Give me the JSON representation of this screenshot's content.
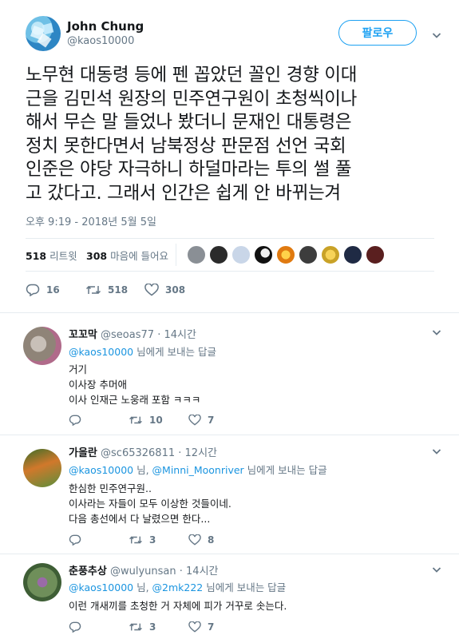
{
  "main_tweet": {
    "author_name": "John Chung",
    "author_handle": "@kaos10000",
    "follow_label": "팔로우",
    "text_lines": [
      "노무현 대동령 등에 펜 꼽았던 꼴인 경향 이대",
      "근을 김민석 원장의 민주연구원이 초청씩이나",
      "해서 무슨 말 들었나 봤더니 문재인 대통령은",
      "정치 못한다면서 남북정상 판문점 선언 국회",
      "인준은 야당 자극하니 하덜마라는 투의 썰 풀",
      "고 갔다고. 그래서 인간은 쉽게 안 바뀌는겨"
    ],
    "timestamp": "오후 9:19 - 2018년 5월 5일",
    "retweets_count": "518",
    "retweets_label": "리트윗",
    "likes_count": "308",
    "likes_label": "마음에 들어요",
    "actions": {
      "replies": "16",
      "retweets": "518",
      "likes": "308"
    }
  },
  "replies": [
    {
      "name": "꼬꼬막",
      "handle": "@seoas77",
      "time": "· 14시간",
      "to_prefix": "",
      "to_mentions": [
        "@kaos10000"
      ],
      "to_suffix": " 님에게 보내는 답글",
      "lines": [
        "거기",
        "이사장 추머애",
        "이사 인재근 노웅래 포함 ㅋㅋㅋ"
      ],
      "replies": "",
      "retweets": "10",
      "likes": "7"
    },
    {
      "name": "가을란",
      "handle": "@sc65326811",
      "time": "· 12시간",
      "to_mentions": [
        "@kaos10000",
        "@Minni_Moonriver"
      ],
      "to_middle": " 님, ",
      "to_suffix": " 님에게 보내는 답글",
      "lines": [
        "한심한 민주연구원..",
        "이사라는 자들이 모두 이상한 것들이네.",
        "다음 총선에서 다 날렸으면 한다..."
      ],
      "replies": "",
      "retweets": "3",
      "likes": "8"
    },
    {
      "name": "춘풍추상",
      "handle": "@wulyunsan",
      "time": "· 14시간",
      "to_mentions": [
        "@kaos10000",
        "@2mk222"
      ],
      "to_middle": " 님, ",
      "to_suffix": " 님에게 보내는 답글",
      "lines": [
        "이런 개새끼를 초청한 거 자체에 피가 거꾸로 솟는다."
      ],
      "replies": "",
      "retweets": "3",
      "likes": "7"
    }
  ],
  "colors": {
    "accent": "#1da1f2",
    "mention": "#1b95e0",
    "muted": "#657786",
    "text": "#14171a",
    "border": "#e6ecf0"
  },
  "icons": [
    "chevron-down-icon",
    "reply-icon",
    "retweet-icon",
    "heart-icon"
  ]
}
